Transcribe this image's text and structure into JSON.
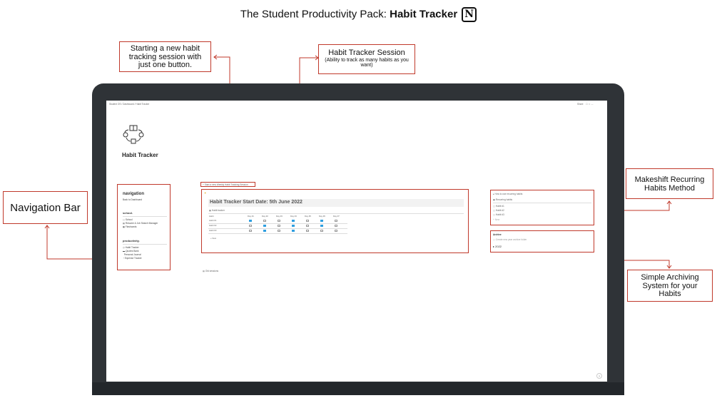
{
  "header": {
    "title_prefix": "The  Student Productivity Pack: ",
    "title_bold": "Habit Tracker",
    "logo_letter": "N"
  },
  "callouts": {
    "new_session": "Starting a new habit tracking session with just one button.",
    "session_title": "Habit Tracker Session",
    "session_sub": "(Ability to track as many habits as you want)",
    "navigation_bar": "Navigation Bar",
    "recurring": "Makeshift Recurring Habits Method",
    "archiving": "Simple Archiving System for your Habits"
  },
  "app": {
    "breadcrumb": "Student OS  /  Dashboard  /  Habit Tracker",
    "share": "Share",
    "page_title": "Habit Tracker",
    "new_session_button": "+ Start a new Weekly Habit Tracking Session",
    "navigation": {
      "heading": "navigation",
      "back_link": "Back to Dashboard",
      "school_heading": "school.",
      "school_items": [
        "School",
        "Resume & Job Search Manager",
        "Flashcards"
      ],
      "productivity_heading": "productivity.",
      "productivity_items": [
        "Habit Tracker",
        "Quotes Bank",
        "Personal Journal",
        "Expense Tracker"
      ]
    },
    "tracker": {
      "title": "Habit Tracker Start Date: 5th June 2022",
      "view_tab": "Habit tracker",
      "columns": [
        "Habit",
        "Day #1",
        "Day #2",
        "Day #3",
        "Day #4",
        "Day #5",
        "Day #6",
        "Day #7"
      ],
      "rows": [
        {
          "name": "Habit #1",
          "checks": [
            true,
            false,
            false,
            true,
            false,
            true,
            false
          ]
        },
        {
          "name": "Habit #2",
          "checks": [
            false,
            true,
            false,
            true,
            false,
            true,
            false
          ]
        },
        {
          "name": "Habit #3",
          "checks": [
            false,
            true,
            false,
            true,
            false,
            false,
            false
          ]
        }
      ],
      "new_row": "+ New"
    },
    "footer_link": "Old sessions",
    "recurring": {
      "toggle": "How to use recurring habits",
      "view_tab": "Recurring habits",
      "items": [
        "Habit #1",
        "Habit #2",
        "Habit #3"
      ],
      "new_row": "+ New"
    },
    "archive": {
      "heading": "Archive",
      "sub": "Create new year archive folder",
      "year": "2022"
    },
    "help_button": "?"
  }
}
